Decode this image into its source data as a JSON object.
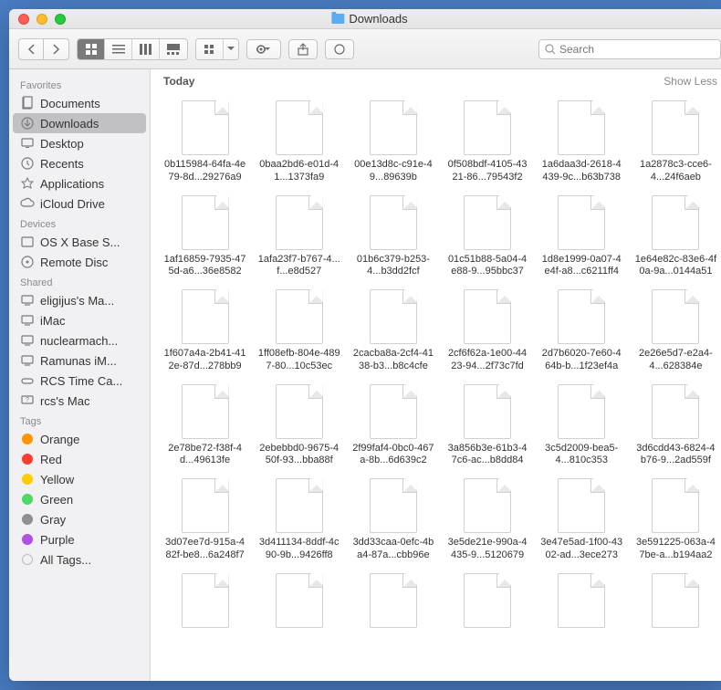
{
  "window": {
    "title": "Downloads"
  },
  "search": {
    "placeholder": "Search"
  },
  "sidebar": {
    "sections": [
      {
        "header": "Favorites",
        "items": [
          {
            "label": "Documents",
            "icon": "documents"
          },
          {
            "label": "Downloads",
            "icon": "downloads",
            "selected": true
          },
          {
            "label": "Desktop",
            "icon": "desktop"
          },
          {
            "label": "Recents",
            "icon": "recents"
          },
          {
            "label": "Applications",
            "icon": "applications"
          },
          {
            "label": "iCloud Drive",
            "icon": "icloud"
          }
        ]
      },
      {
        "header": "Devices",
        "items": [
          {
            "label": "OS X Base S...",
            "icon": "disk"
          },
          {
            "label": "Remote Disc",
            "icon": "disc"
          }
        ]
      },
      {
        "header": "Shared",
        "items": [
          {
            "label": "eligijus's Ma...",
            "icon": "monitor"
          },
          {
            "label": "iMac",
            "icon": "monitor"
          },
          {
            "label": "nuclearmach...",
            "icon": "monitor"
          },
          {
            "label": "Ramunas iM...",
            "icon": "monitor"
          },
          {
            "label": "RCS Time Ca...",
            "icon": "timecapsule"
          },
          {
            "label": "rcs's Mac",
            "icon": "question"
          }
        ]
      },
      {
        "header": "Tags",
        "items": [
          {
            "label": "Orange",
            "tag": "#ff9500"
          },
          {
            "label": "Red",
            "tag": "#ff3b30"
          },
          {
            "label": "Yellow",
            "tag": "#ffcc00"
          },
          {
            "label": "Green",
            "tag": "#4cd964"
          },
          {
            "label": "Gray",
            "tag": "#8e8e93"
          },
          {
            "label": "Purple",
            "tag": "#b150e2"
          },
          {
            "label": "All Tags...",
            "tag": ""
          }
        ]
      }
    ]
  },
  "content": {
    "section_label": "Today",
    "show_less": "Show Less",
    "files": [
      {
        "name": "0b115984-64fa-4e79-8d...29276a9"
      },
      {
        "name": "0baa2bd6-e01d-41...1373fa9"
      },
      {
        "name": "00e13d8c-c91e-49...89639b"
      },
      {
        "name": "0f508bdf-4105-4321-86...79543f2"
      },
      {
        "name": "1a6daa3d-2618-4439-9c...b63b738"
      },
      {
        "name": "1a2878c3-cce6-4...24f6aeb"
      },
      {
        "name": "1af16859-7935-475d-a6...36e8582"
      },
      {
        "name": "1afa23f7-b767-4...f...e8d527"
      },
      {
        "name": "01b6c379-b253-4...b3dd2fcf"
      },
      {
        "name": "01c51b88-5a04-4e88-9...95bbc37"
      },
      {
        "name": "1d8e1999-0a07-4e4f-a8...c6211ff4"
      },
      {
        "name": "1e64e82c-83e6-4f0a-9a...0144a51"
      },
      {
        "name": "1f607a4a-2b41-412e-87d...278bb9"
      },
      {
        "name": "1ff08efb-804e-4897-80...10c53ec"
      },
      {
        "name": "2cacba8a-2cf4-4138-b3...b8c4cfe"
      },
      {
        "name": "2cf6f62a-1e00-4423-94...2f73c7fd"
      },
      {
        "name": "2d7b6020-7e60-464b-b...1f23ef4a"
      },
      {
        "name": "2e26e5d7-e2a4-4...628384e"
      },
      {
        "name": "2e78be72-f38f-4d...49613fe"
      },
      {
        "name": "2ebebbd0-9675-450f-93...bba88f"
      },
      {
        "name": "2f99faf4-0bc0-467a-8b...6d639c2"
      },
      {
        "name": "3a856b3e-61b3-47c6-ac...b8dd84"
      },
      {
        "name": "3c5d2009-bea5-4...810c353"
      },
      {
        "name": "3d6cdd43-6824-4b76-9...2ad559f"
      },
      {
        "name": "3d07ee7d-915a-482f-be8...6a248f7"
      },
      {
        "name": "3d411134-8ddf-4c90-9b...9426ff8"
      },
      {
        "name": "3dd33caa-0efc-4ba4-87a...cbb96e"
      },
      {
        "name": "3e5de21e-990a-4435-9...5120679"
      },
      {
        "name": "3e47e5ad-1f00-4302-ad...3ece273"
      },
      {
        "name": "3e591225-063a-47be-a...b194aa2"
      },
      {
        "name": ""
      },
      {
        "name": ""
      },
      {
        "name": ""
      },
      {
        "name": ""
      },
      {
        "name": ""
      },
      {
        "name": ""
      }
    ]
  }
}
